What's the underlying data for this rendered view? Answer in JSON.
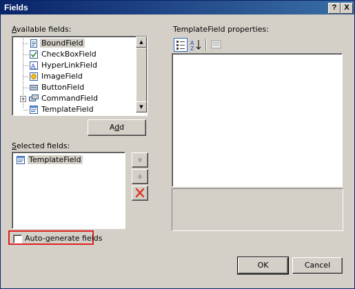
{
  "window": {
    "title": "Fields",
    "help_label": "?",
    "close_label": "X"
  },
  "available": {
    "label_ul": "A",
    "label_rest": "vailable fields:",
    "items": [
      {
        "label": "BoundField",
        "icon": "boundfield-icon"
      },
      {
        "label": "CheckBoxField",
        "icon": "checkboxfield-icon"
      },
      {
        "label": "HyperLinkField",
        "icon": "hyperlinkfield-icon"
      },
      {
        "label": "ImageField",
        "icon": "imagefield-icon"
      },
      {
        "label": "ButtonField",
        "icon": "buttonfield-icon"
      },
      {
        "label": "CommandField",
        "icon": "commandfield-icon"
      },
      {
        "label": "TemplateField",
        "icon": "templatefield-icon"
      }
    ],
    "selected_index": 0
  },
  "add_button": {
    "label_pre": "A",
    "label_ul": "d",
    "label_post": "d"
  },
  "selected": {
    "label_ul": "S",
    "label_rest": "elected fields:",
    "items": [
      {
        "label": "TemplateField",
        "icon": "templatefield-icon"
      }
    ]
  },
  "auto_generate": {
    "label_pre": "Auto-",
    "label_ul": "g",
    "label_post": "enerate fields",
    "checked": false
  },
  "properties": {
    "label": "TemplateField properties:"
  },
  "ok_label": "OK",
  "cancel_label": "Cancel",
  "colors": {
    "title_start": "#0a246a",
    "title_end": "#3a6ea5",
    "highlight_border": "#e02020",
    "delete_red": "#e03020"
  }
}
